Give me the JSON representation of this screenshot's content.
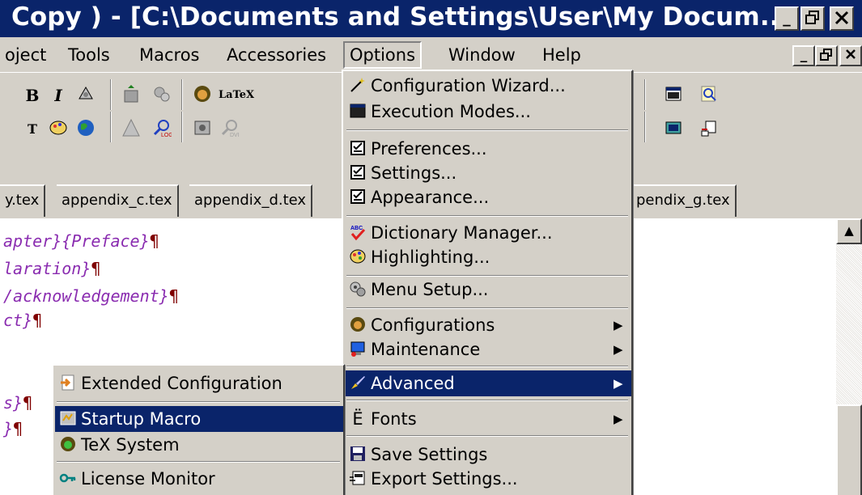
{
  "window": {
    "title": "Copy ) - [C:\\Documents and Settings\\User\\My Docum...",
    "minimize_glyph": "_",
    "restore_glyph": "🗗",
    "close_glyph": "✕"
  },
  "menubar": {
    "items": [
      "oject",
      "Tools",
      "Macros",
      "Accessories",
      "Options",
      "Window",
      "Help"
    ],
    "mdi_minimize_glyph": "_",
    "mdi_restore_glyph": "🗗",
    "mdi_close_glyph": "✕"
  },
  "toolbar": {
    "bold": "B",
    "italic": "I",
    "typewriter": "T",
    "latex": "LaTeX",
    "icons": [
      "bold-icon",
      "italic-icon",
      "font-icon",
      "spellcheck-icon",
      "gears-icon",
      "lion-icon",
      "latex-icon",
      "typewriter-icon",
      "highlight-icon",
      "globe-icon",
      "triangle-icon",
      "log-search-icon",
      "compile-icon",
      "dvi-icon",
      "window-icon",
      "search-doc-icon",
      "terminal-icon",
      "export-icon"
    ]
  },
  "tabs": [
    "y.tex",
    "appendix_c.tex",
    "appendix_d.tex",
    "pendix_g.tex"
  ],
  "editor": {
    "lines": [
      "apter}{Preface}",
      "laration}",
      "/acknowledgement}",
      "ct}",
      "s}",
      "}"
    ],
    "pilcrow": "¶"
  },
  "scrollbar": {
    "up_glyph": "▲"
  },
  "options_menu": {
    "items": [
      {
        "label": "Configuration Wizard...",
        "icon": "wand-icon",
        "glyph": "✨",
        "submenu": false
      },
      {
        "label": "Execution Modes...",
        "icon": "window-icon",
        "glyph": "▀",
        "submenu": false
      },
      {
        "label": "Preferences...",
        "icon": "checklist-icon",
        "glyph": "☑",
        "submenu": false
      },
      {
        "label": "Settings...",
        "icon": "checklist-icon",
        "glyph": "☑",
        "submenu": false
      },
      {
        "label": "Appearance...",
        "icon": "checklist-icon",
        "glyph": "☑",
        "submenu": false
      },
      {
        "label": "Dictionary Manager...",
        "icon": "spellcheck-icon",
        "glyph": "✔",
        "submenu": false
      },
      {
        "label": "Highlighting...",
        "icon": "palette-icon",
        "glyph": "🎨",
        "submenu": false
      },
      {
        "label": "Menu Setup...",
        "icon": "gears-icon",
        "glyph": "⚙",
        "submenu": false
      },
      {
        "label": "Configurations",
        "icon": "lion-icon",
        "glyph": "♞",
        "submenu": true
      },
      {
        "label": "Maintenance",
        "icon": "computer-icon",
        "glyph": "🖥",
        "submenu": true
      },
      {
        "label": "Advanced",
        "icon": "brush-icon",
        "glyph": "🖌",
        "submenu": true
      },
      {
        "label": "Fonts",
        "icon": "fonts-icon",
        "glyph": "Ë",
        "submenu": true
      },
      {
        "label": "Save Settings",
        "icon": "floppy-icon",
        "glyph": "💾",
        "submenu": false
      },
      {
        "label": "Export Settings...",
        "icon": "export-icon",
        "glyph": "⚡",
        "submenu": false
      }
    ],
    "arrow_glyph": "▶"
  },
  "advanced_submenu": {
    "items": [
      {
        "label": "Extended Configuration",
        "icon": "arrow-page-icon",
        "glyph": "➔"
      },
      {
        "label": "Startup Macro",
        "icon": "macro-icon",
        "glyph": "✱"
      },
      {
        "label": "TeX System",
        "icon": "lion-icon",
        "glyph": "♞"
      },
      {
        "label": "License Monitor",
        "icon": "key-icon",
        "glyph": "⚷"
      }
    ]
  },
  "colors": {
    "titlebar": "#0a246a",
    "highlight": "#0a246a",
    "face": "#d4d0c8",
    "code": "#8a2cb0",
    "pilcrow": "#800000"
  }
}
